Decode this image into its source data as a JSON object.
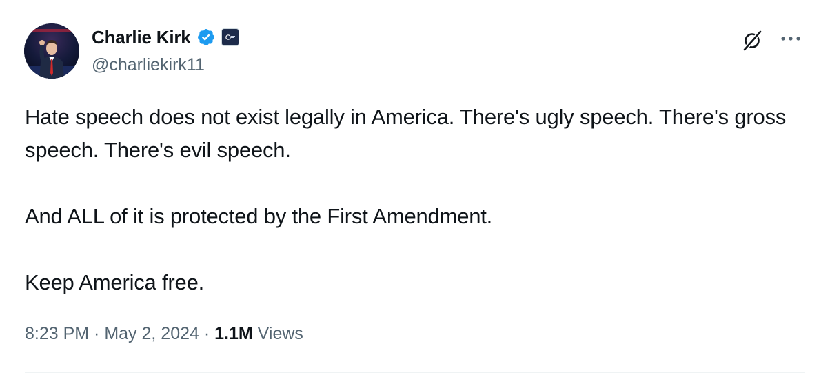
{
  "author": {
    "display_name": "Charlie Kirk",
    "handle": "@charliekirk11",
    "verified": true
  },
  "icons": {
    "verified": "verified-badge-icon",
    "affiliate": "affiliate-badge-icon",
    "grok": "grok-icon",
    "more": "more-icon"
  },
  "colors": {
    "verified_blue": "#1d9bf0",
    "text": "#0f1419",
    "secondary": "#536471"
  },
  "tweet": {
    "paragraphs": [
      "Hate speech does not exist legally in America. There's ugly speech. There's gross speech. There's evil speech.",
      "And ALL of it is protected by the First Amendment.",
      "Keep America free."
    ],
    "time": "8:23 PM",
    "separator": " · ",
    "date": "May 2, 2024",
    "views_count": "1.1M",
    "views_label": " Views"
  }
}
